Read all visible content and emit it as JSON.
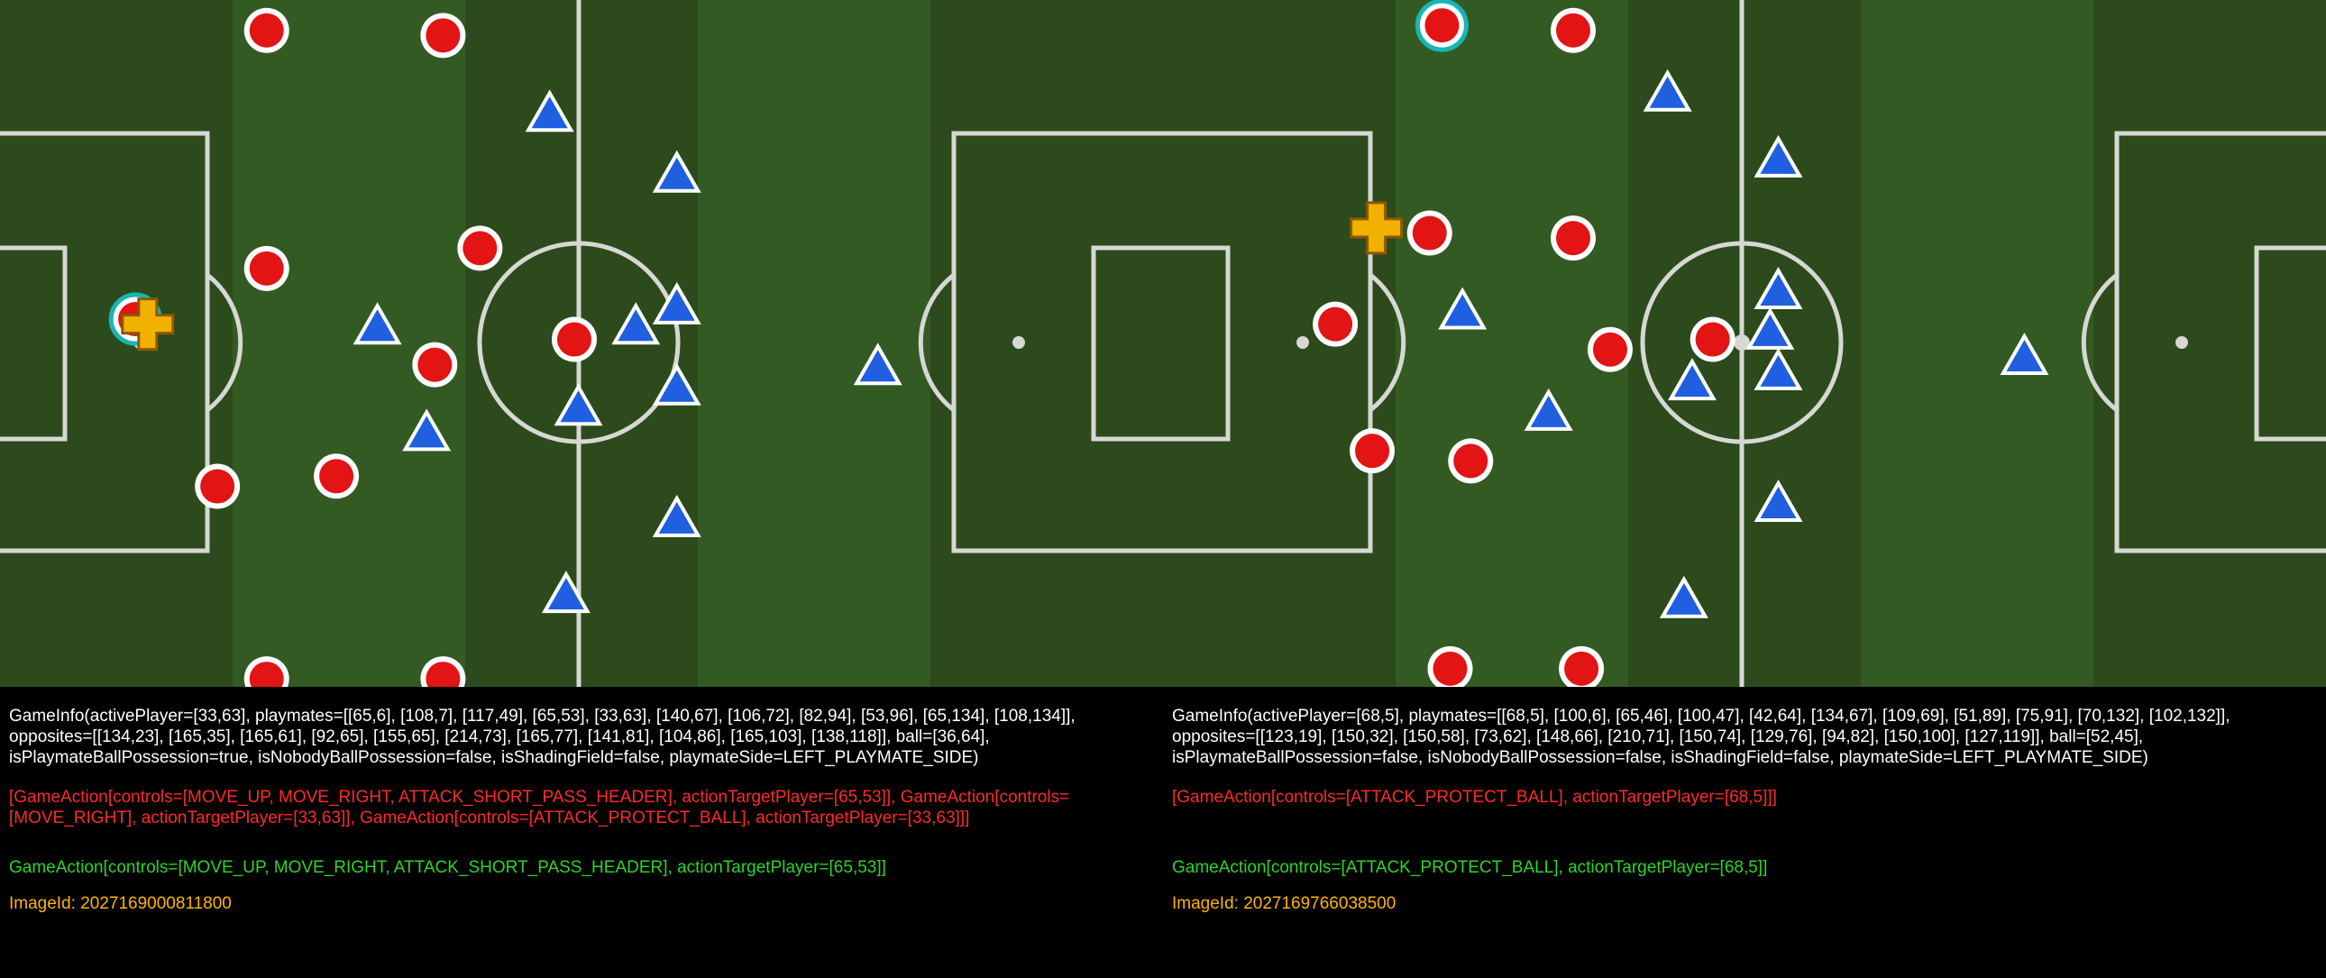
{
  "colors": {
    "pitch_dark": "#2c4a1c",
    "pitch_light": "#345a23",
    "line": "#d6d8d2",
    "teammate": "#e21414",
    "opponent": "#1f5fe0",
    "ball": "#f2b100",
    "gameinfo_text": "#ffffff",
    "actions_text": "#ff2a2a",
    "chosen_action_text": "#2ad62a",
    "image_id_text": "#ffb400"
  },
  "icons": {
    "teammate": "red-circle-icon",
    "opponent": "blue-triangle-icon",
    "ball": "yellow-cross-icon",
    "active_marker": "cyan-ring-icon"
  },
  "panels": [
    {
      "game_info": "GameInfo(activePlayer=[33,63], playmates=[[65,6], [108,7], [117,49], [65,53], [33,63], [140,67], [106,72], [82,94], [53,96], [65,134], [108,134]], opposites=[[134,23], [165,35], [165,61], [92,65], [155,65], [214,73], [165,77], [141,81], [104,86], [165,103], [138,118]], ball=[36,64], isPlaymateBallPossession=true, isNobodyBallPossession=false, isShadingField=false, playmateSide=LEFT_PLAYMATE_SIDE)",
      "actions": "[GameAction[controls=[MOVE_UP, MOVE_RIGHT, ATTACK_SHORT_PASS_HEADER], actionTargetPlayer=[65,53]], GameAction[controls=[MOVE_RIGHT], actionTargetPlayer=[33,63]], GameAction[controls=[ATTACK_PROTECT_BALL], actionTargetPlayer=[33,63]]]",
      "chosen_action": "GameAction[controls=[MOVE_UP, MOVE_RIGHT, ATTACK_SHORT_PASS_HEADER], actionTargetPlayer=[65,53]]",
      "image_id": "ImageId: 2027169000811800",
      "field": {
        "active_player": [
          33,
          63
        ],
        "playmates": [
          [
            65,
            6
          ],
          [
            108,
            7
          ],
          [
            117,
            49
          ],
          [
            65,
            53
          ],
          [
            33,
            63
          ],
          [
            140,
            67
          ],
          [
            106,
            72
          ],
          [
            82,
            94
          ],
          [
            53,
            96
          ],
          [
            65,
            134
          ],
          [
            108,
            134
          ]
        ],
        "opposites": [
          [
            134,
            23
          ],
          [
            165,
            35
          ],
          [
            165,
            61
          ],
          [
            92,
            65
          ],
          [
            155,
            65
          ],
          [
            214,
            73
          ],
          [
            165,
            77
          ],
          [
            141,
            81
          ],
          [
            104,
            86
          ],
          [
            165,
            103
          ],
          [
            138,
            118
          ]
        ],
        "ball": [
          36,
          64
        ]
      }
    },
    {
      "game_info": "GameInfo(activePlayer=[68,5], playmates=[[68,5], [100,6], [65,46], [100,47], [42,64], [134,67], [109,69], [51,89], [75,91], [70,132], [102,132]], opposites=[[123,19], [150,32], [150,58], [73,62], [148,66], [210,71], [150,74], [129,76], [94,82], [150,100], [127,119]], ball=[52,45], isPlaymateBallPossession=false, isNobodyBallPossession=false, isShadingField=false, playmateSide=LEFT_PLAYMATE_SIDE)",
      "actions": "[GameAction[controls=[ATTACK_PROTECT_BALL], actionTargetPlayer=[68,5]]]",
      "chosen_action": "GameAction[controls=[ATTACK_PROTECT_BALL], actionTargetPlayer=[68,5]]",
      "image_id": "ImageId: 2027169766038500",
      "field": {
        "active_player": [
          68,
          5
        ],
        "playmates": [
          [
            68,
            5
          ],
          [
            100,
            6
          ],
          [
            65,
            46
          ],
          [
            100,
            47
          ],
          [
            42,
            64
          ],
          [
            134,
            67
          ],
          [
            109,
            69
          ],
          [
            51,
            89
          ],
          [
            75,
            91
          ],
          [
            70,
            132
          ],
          [
            102,
            132
          ]
        ],
        "opposites": [
          [
            123,
            19
          ],
          [
            150,
            32
          ],
          [
            150,
            58
          ],
          [
            73,
            62
          ],
          [
            148,
            66
          ],
          [
            210,
            71
          ],
          [
            150,
            74
          ],
          [
            129,
            76
          ],
          [
            94,
            82
          ],
          [
            150,
            100
          ],
          [
            127,
            119
          ]
        ],
        "ball": [
          52,
          45
        ]
      }
    }
  ]
}
